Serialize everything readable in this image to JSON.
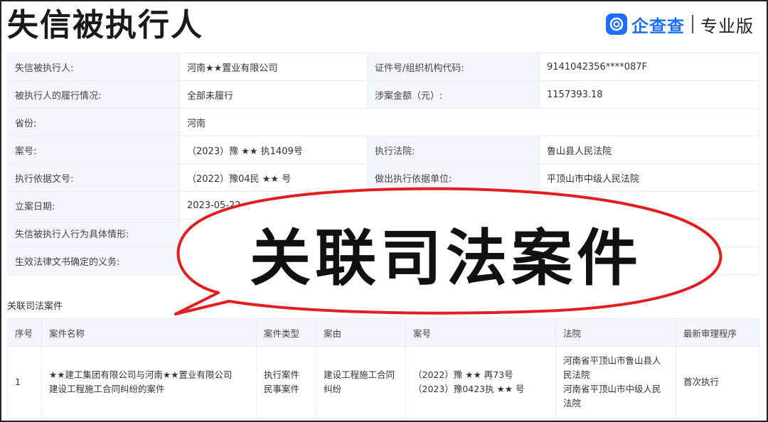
{
  "header": {
    "title": "失信被执行人",
    "brand_name": "企查查",
    "brand_tag": "专业版"
  },
  "info": {
    "row1": {
      "label1": "失信被执行人:",
      "value1": "河南★★置业有限公司",
      "label2": "证件号/组织机构代码:",
      "value2": "9141042356****087F"
    },
    "row2": {
      "label1": "被执行人的履行情况:",
      "value1": "全部未履行",
      "label2": "涉案金额（元）:",
      "value2": "1157393.18"
    },
    "row3": {
      "label1": "省份:",
      "value1": "河南"
    },
    "row4": {
      "label1": "案号:",
      "value1": "（2023）豫 ★★ 执1409号",
      "label2": "执行法院:",
      "value2": "鲁山县人民法院"
    },
    "row5": {
      "label1": "执行依据文号:",
      "value1": "（2022）豫04民 ★★ 号",
      "label2": "做出执行依据单位:",
      "value2": "平顶山市中级人民法院"
    },
    "row6": {
      "label1": "立案日期:",
      "value1": "2023-05-22"
    },
    "row7": {
      "label1": "失信被执行人行为具体情形:"
    },
    "row8": {
      "label1": "生效法律文书确定的义务:"
    }
  },
  "related": {
    "section_label": "关联司法案件",
    "columns": [
      "序号",
      "案件名称",
      "案件类型",
      "案由",
      "案号",
      "法院",
      "最新审理程序"
    ],
    "row": {
      "index": "1",
      "name_line1": "★★建工集团有限公司与河南★★置业有限公司",
      "name_line2": "建设工程施工合同纠纷的案件",
      "type_line1": "执行案件",
      "type_line2": "民事案件",
      "cause_line1": "建设工程施工合同",
      "cause_line2": "纠纷",
      "case_no_line1": "（2022）豫 ★★ 再73号",
      "case_no_line2": "（2023）豫0423执 ★★ 号",
      "court1_line1": "河南省平顶山市鲁山县人",
      "court1_line2": "民法院",
      "court2_line1": "河南省平顶山市中级人民",
      "court2_line2": "法院",
      "procedure": "首次执行"
    }
  },
  "overlay": {
    "bubble_text": "关联司法案件"
  },
  "colors": {
    "accent": "#1e6fff",
    "bubble_outline": "#e02020",
    "label_bg": "#f2f7fd"
  }
}
